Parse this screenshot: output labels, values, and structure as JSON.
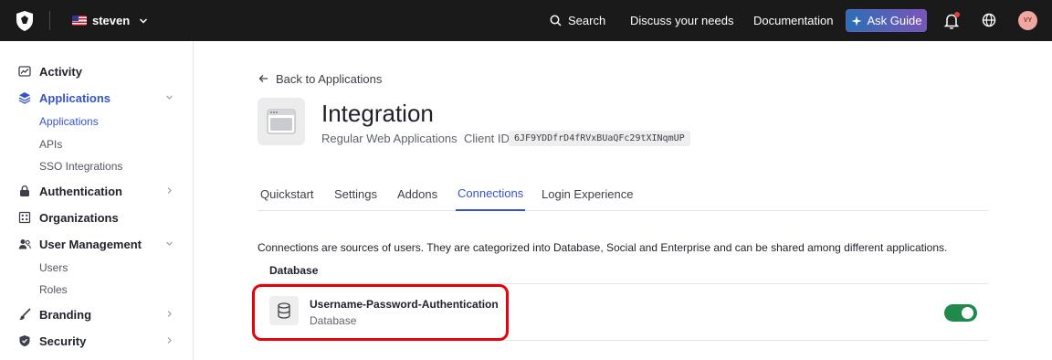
{
  "topbar": {
    "tenant": "steven",
    "search": "Search",
    "discuss": "Discuss your needs",
    "docs": "Documentation",
    "ask": "Ask Guide",
    "avatar_initials": "VY"
  },
  "sidebar": {
    "activity": "Activity",
    "applications": "Applications",
    "applications_sub": [
      "Applications",
      "APIs",
      "SSO Integrations"
    ],
    "authentication": "Authentication",
    "organizations": "Organizations",
    "user_management": "User Management",
    "user_management_sub": [
      "Users",
      "Roles"
    ],
    "branding": "Branding",
    "security": "Security"
  },
  "main": {
    "back": "Back to Applications",
    "app_title": "Integration",
    "app_type": "Regular Web Applications",
    "client_id_label": "Client ID",
    "client_id": "6JF9YDDfrD4fRVxBUaQFc29tXINqmUP",
    "tabs": [
      "Quickstart",
      "Settings",
      "Addons",
      "Connections",
      "Login Experience"
    ],
    "description": "Connections are sources of users. They are categorized into Database, Social and Enterprise and can be shared among different applications.",
    "section_title": "Database",
    "connection": {
      "name": "Username-Password-Authentication",
      "type": "Database",
      "enabled": true
    }
  },
  "colors": {
    "accent": "#3653cf",
    "toggle_on": "#1f8a4c",
    "highlight": "#e8000b",
    "topbar": "#1a1a1a"
  }
}
